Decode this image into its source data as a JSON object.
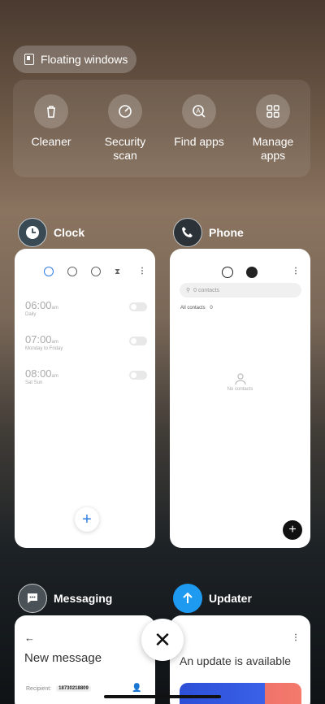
{
  "floating": {
    "label": "Floating windows"
  },
  "quick_actions": [
    {
      "label": "Cleaner",
      "icon": "trash-icon"
    },
    {
      "label": "Security\nscan",
      "icon": "shield-check-icon"
    },
    {
      "label": "Find apps",
      "icon": "find-apps-icon"
    },
    {
      "label": "Manage\napps",
      "icon": "grid-icon"
    }
  ],
  "apps": {
    "clock": {
      "title": "Clock",
      "alarms": [
        {
          "time": "06:00",
          "ampm": "am",
          "sub": "Daily"
        },
        {
          "time": "07:00",
          "ampm": "am",
          "sub": "Monday to Friday"
        },
        {
          "time": "08:00",
          "ampm": "am",
          "sub": "Sat Sun"
        }
      ]
    },
    "phone": {
      "title": "Phone",
      "search_placeholder": "0 contacts",
      "all_contacts": "All contacts",
      "all_contacts_count": "0",
      "empty_text": "No contacts"
    },
    "messaging": {
      "title": "Messaging",
      "screen_title": "New message",
      "recipient_label": "Recipient:",
      "recipient_chip": "18730218809"
    },
    "updater": {
      "title": "Updater",
      "headline": "An update is available"
    }
  },
  "colors": {
    "accent_blue": "#2f7be0",
    "updater_blue": "#1e9bf0"
  }
}
